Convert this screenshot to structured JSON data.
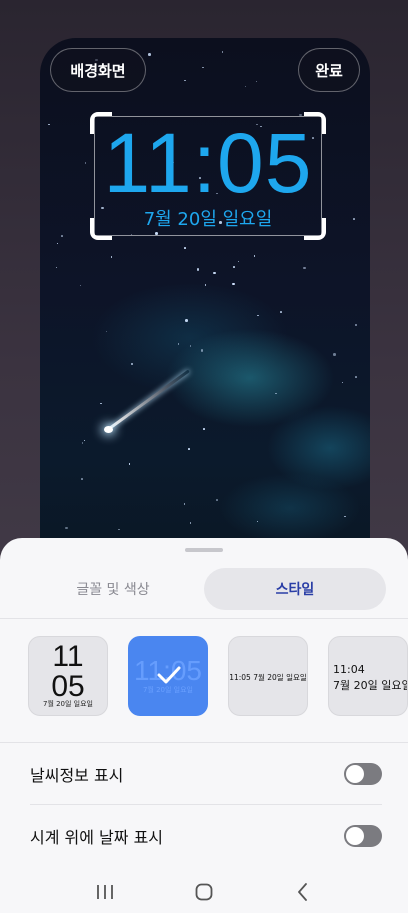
{
  "preview": {
    "background_button": "배경화면",
    "done_button": "완료",
    "clock_time": "11:05",
    "clock_date": "7월 20일 일요일",
    "clock_color": "#1ea7ee"
  },
  "tabs": [
    {
      "label": "글꼴 및 색상",
      "active": false
    },
    {
      "label": "스타일",
      "active": true
    }
  ],
  "styles": [
    {
      "time_hours": "11",
      "time_minutes": "05",
      "date": "7월 20일 일요일"
    },
    {
      "time": "11:05",
      "date": "7월 20일 일요일",
      "selected": true
    },
    {
      "text": "11:05 7월 20일 일요일"
    },
    {
      "time": "11:04",
      "date": "7월 20일 일요일"
    }
  ],
  "settings": [
    {
      "label": "날씨정보 표시",
      "enabled": false
    },
    {
      "label": "시계 위에 날짜 표시",
      "enabled": false
    }
  ],
  "nav": {
    "recents": "recents-icon",
    "home": "home-icon",
    "back": "back-icon"
  },
  "accent_color": "#4a86f0"
}
